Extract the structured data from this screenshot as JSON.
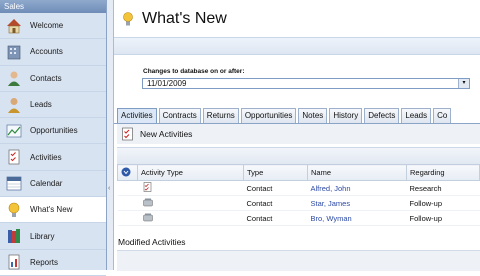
{
  "sidebar": {
    "header": "Sales",
    "items": [
      {
        "label": "Welcome",
        "icon": "house-icon"
      },
      {
        "label": "Accounts",
        "icon": "building-icon"
      },
      {
        "label": "Contacts",
        "icon": "person-icon"
      },
      {
        "label": "Leads",
        "icon": "lead-person-icon"
      },
      {
        "label": "Opportunities",
        "icon": "chart-icon"
      },
      {
        "label": "Activities",
        "icon": "checklist-icon"
      },
      {
        "label": "Calendar",
        "icon": "calendar-icon"
      },
      {
        "label": "What's New",
        "icon": "lightbulb-icon",
        "active": true
      },
      {
        "label": "Library",
        "icon": "books-icon"
      },
      {
        "label": "Reports",
        "icon": "reports-icon"
      }
    ]
  },
  "page": {
    "title": "What's New",
    "changes_label": "Changes to database on or after:",
    "date_value": "11/01/2009"
  },
  "tabs": [
    "Activities",
    "Contracts",
    "Returns",
    "Opportunities",
    "Notes",
    "History",
    "Defects",
    "Leads",
    "Co"
  ],
  "new_activities": {
    "title": "New Activities",
    "columns": [
      "Activity Type",
      "Type",
      "Name",
      "Regarding"
    ],
    "rows": [
      {
        "type": "Contact",
        "name": "Alfred, John",
        "regarding": "Research"
      },
      {
        "type": "Contact",
        "name": "Star, James",
        "regarding": "Follow-up"
      },
      {
        "type": "Contact",
        "name": "Bro, Wyman",
        "regarding": "Follow-up"
      }
    ]
  },
  "modified": {
    "title": "Modified Activities"
  },
  "colors": {
    "sidebar_bg": "#d8e3f1",
    "header_bg": "#7b97c0",
    "link": "#2c4aa6",
    "accent": "#e8a92a"
  }
}
